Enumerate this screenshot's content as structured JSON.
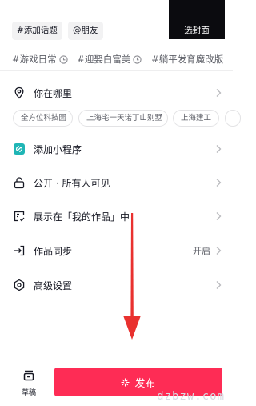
{
  "chips": [
    {
      "prefix": "#",
      "label": "添加话题"
    },
    {
      "prefix": "@",
      "label": "朋友"
    }
  ],
  "cover": {
    "label": "选封面"
  },
  "topics": [
    "#游戏日常",
    "#迎娶白富美",
    "#躺平发育魔改版"
  ],
  "location": {
    "label": "你在哪里",
    "suggestions": [
      "全方位科技园",
      "上海宅一天诺丁山别墅",
      "上海建工"
    ]
  },
  "mini_program": {
    "label": "添加小程序"
  },
  "visibility": {
    "label": "公开 · 所有人可见"
  },
  "showcase": {
    "label": "展示在「我的作品」中"
  },
  "sync": {
    "label": "作品同步",
    "value": "开启"
  },
  "advanced": {
    "label": "高级设置"
  },
  "footer": {
    "draft_label": "草稿",
    "publish_label": "发布"
  },
  "watermark": "dzbzw.com",
  "colors": {
    "accent": "#fe2c55",
    "mini_program_icon": "#1fb5b5",
    "annotation_arrow": "#e9312f"
  }
}
